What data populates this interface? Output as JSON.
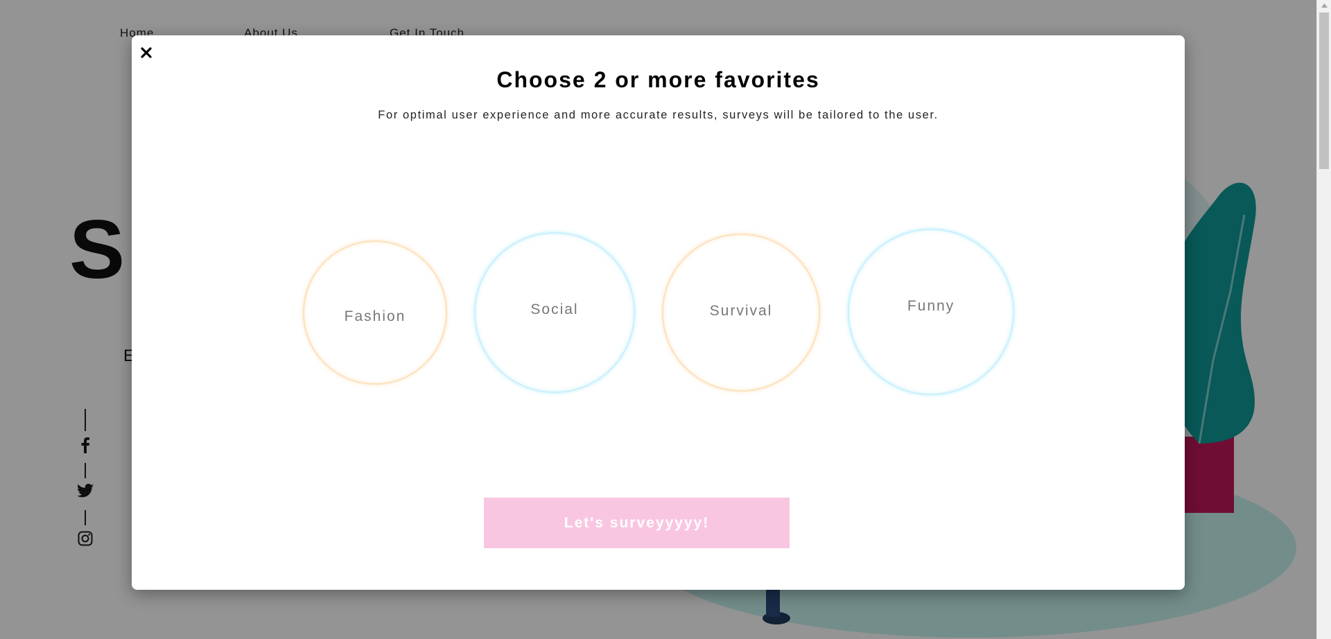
{
  "nav": {
    "items": [
      {
        "label": "Home"
      },
      {
        "label": "About Us"
      },
      {
        "label": "Get In Touch"
      }
    ]
  },
  "hero": {
    "letter": "S",
    "sub_letter": "E"
  },
  "social": {
    "icons": [
      "facebook-icon",
      "twitter-icon",
      "instagram-icon"
    ]
  },
  "modal": {
    "close_label": "×",
    "title": "Choose 2 or more favorites",
    "subtitle": "For optimal user experience and more accurate results, surveys will be tailored to the user.",
    "categories": [
      {
        "label": "Fashion",
        "ring": "peach"
      },
      {
        "label": "Social",
        "ring": "cyan"
      },
      {
        "label": "Survival",
        "ring": "peach"
      },
      {
        "label": "Funny",
        "ring": "cyan"
      }
    ],
    "submit_label": "Let's surveyyyyy!"
  },
  "colors": {
    "overlay": "#000000",
    "submit_bg": "#f9c6e1",
    "ring_peach": "#fde2bd",
    "ring_cyan": "#c9f1fb",
    "plant": "#0e9a98",
    "pot": "#c2185b",
    "floor": "#c7f3ee"
  }
}
